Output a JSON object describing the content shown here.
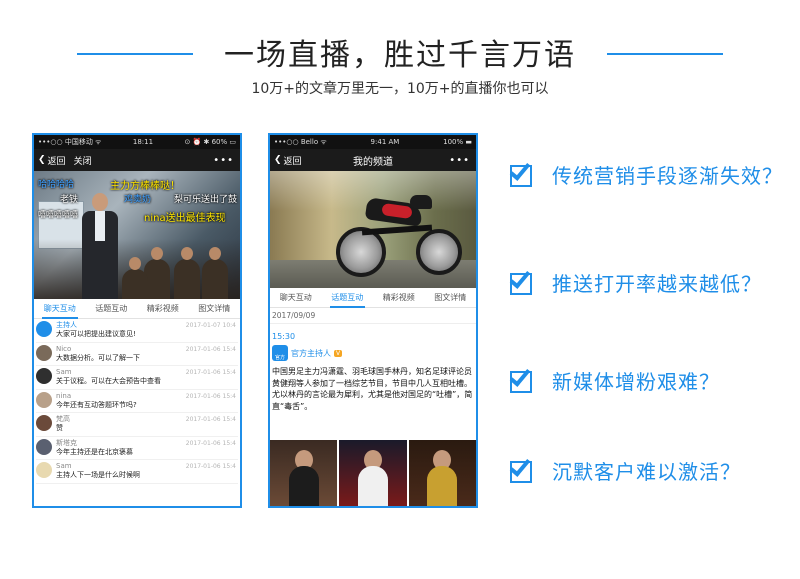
{
  "header": {
    "title": "一场直播，胜过千言万语",
    "subtitle": "10万+的文章万里无一，10万+的直播你也可以"
  },
  "colors": {
    "accent": "#1f8ee8"
  },
  "phone1": {
    "status": {
      "carrier": "•••○○ 中国移动 ᯤ",
      "time": "18:11",
      "right": "⊙ ⏰ ✱ 60% ▭"
    },
    "nav": {
      "back": "返回",
      "close": "关闭",
      "more": "•••"
    },
    "danmu": [
      {
        "text": "哈哈哈哈",
        "color": "#3fa0ff"
      },
      {
        "text": "主力方棒棒哒！",
        "color": "#ffe600"
      },
      {
        "text": "老铁",
        "color": "#ffffff"
      },
      {
        "text": "鸡卖奶",
        "color": "#3fa0ff"
      },
      {
        "text": "梨可乐送出了鼓",
        "color": "#ffffff"
      },
      {
        "text": "嘻嘻嘻嘻嘻",
        "color": "#ffffff"
      },
      {
        "text": "nina送出最佳表现",
        "color": "#ffe600"
      }
    ],
    "tabs": [
      "聊天互动",
      "话题互动",
      "精彩视频",
      "图文详情"
    ],
    "chat": [
      {
        "name": "主持人",
        "msg": "大家可以把提出建议意见!",
        "time": "2017-01-07 10:4",
        "avatar": "#1f8ee8",
        "nameColor": "#1f8ee8"
      },
      {
        "name": "Nico",
        "msg": "大数据分析。可以了解一下",
        "time": "2017-01-06 15:4",
        "avatar": "#7a6a5a",
        "nameColor": "#8a8a8a"
      },
      {
        "name": "Sam",
        "msg": "关于议程。可以在大会预告中查看",
        "time": "2017-01-06 15:4",
        "avatar": "#2f2f2f",
        "nameColor": "#8a8a8a"
      },
      {
        "name": "nina",
        "msg": "今年还有互动答题环节吗?",
        "time": "2017-01-06 15:4",
        "avatar": "#b8a089",
        "nameColor": "#8a8a8a"
      },
      {
        "name": "梵高",
        "msg": "赞",
        "time": "2017-01-06 15:4",
        "avatar": "#6b4a3a",
        "nameColor": "#8a8a8a"
      },
      {
        "name": "斯塔克",
        "msg": "今年主持还是在北京褒慕",
        "time": "2017-01-06 15:4",
        "avatar": "#5a6070",
        "nameColor": "#8a8a8a"
      },
      {
        "name": "Sam",
        "msg": "主持人下一场是什么时候啊",
        "time": "2017-01-06 15:4",
        "avatar": "#e8d9b0",
        "nameColor": "#8a8a8a"
      }
    ]
  },
  "phone2": {
    "status": {
      "carrier": "•••○○ Bello ᯤ",
      "time": "9:41 AM",
      "right": "100% ▬"
    },
    "nav": {
      "back": "返回",
      "title": "我的频道",
      "more": "•••"
    },
    "tabs": [
      "聊天互动",
      "话题互动",
      "精彩视频",
      "图文详情"
    ],
    "date": "2017/09/09",
    "time": "15:30",
    "host": "官方主持人",
    "host_logo": "官方",
    "badge": "V",
    "article": "中国男足主力冯潇霆、羽毛球国手林丹，知名足球评论员黄健翔等人参加了一档综艺节目，节目中几人互相吐槽。尤以林丹的言论最为犀利，尤其是他对国足的“吐槽”，简直“毒舌”。"
  },
  "bullets": [
    "传统营销手段逐渐失效？",
    "推送打开率越来越低？",
    "新媒体增粉艰难？",
    "沉默客户难以激活？"
  ]
}
